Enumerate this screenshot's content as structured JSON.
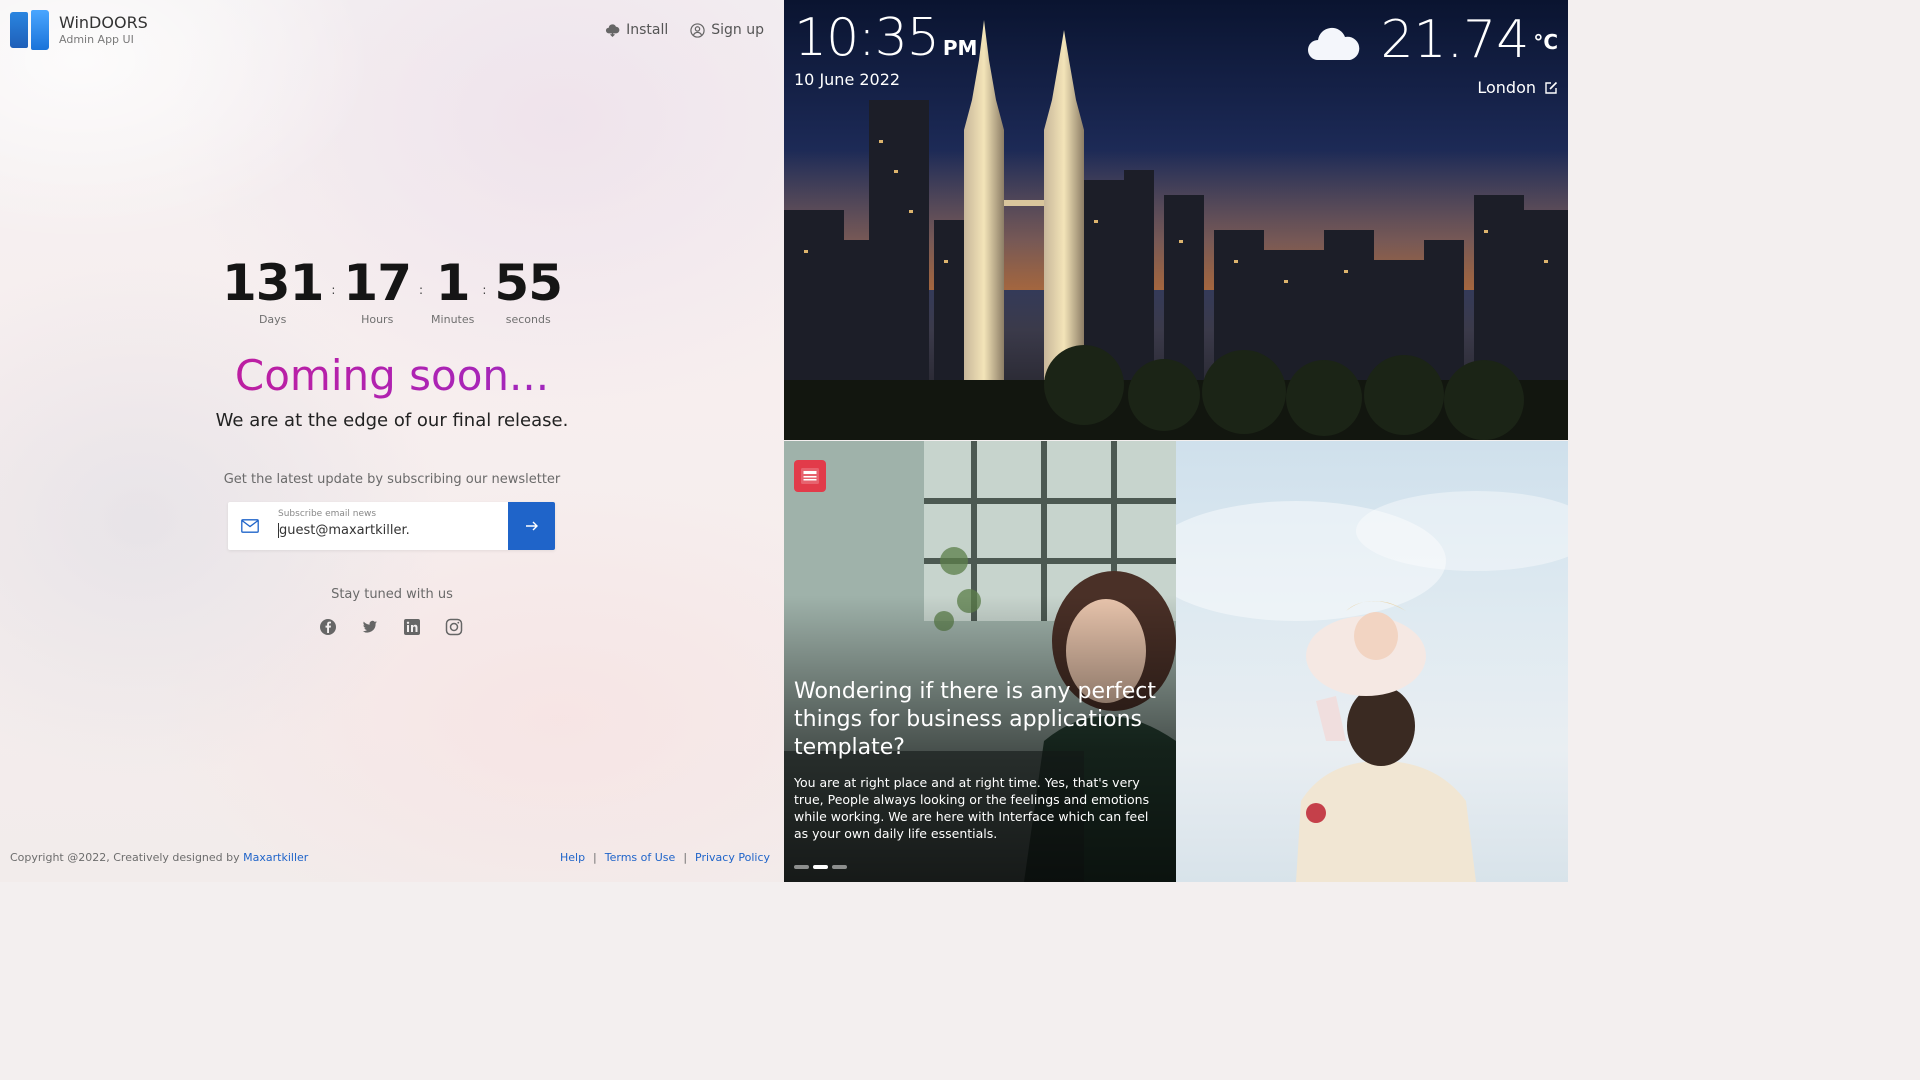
{
  "brand": {
    "title": "WinDOORS",
    "subtitle": "Admin App UI"
  },
  "topnav": {
    "install": "Install",
    "signup": "Sign up"
  },
  "countdown": {
    "days": "131",
    "days_label": "Days",
    "hours": "17",
    "hours_label": "Hours",
    "minutes": "1",
    "minutes_label": "Minutes",
    "seconds": "55",
    "seconds_label": "seconds",
    "separator": ":"
  },
  "hero": {
    "title": "Coming soon...",
    "tagline": "We are at the edge of our final release."
  },
  "newsletter": {
    "hint": "Get the latest update by subscribing our newsletter",
    "field_label": "Subscribe email news",
    "email_value": "guest@maxartkiller."
  },
  "social": {
    "heading": "Stay tuned with us",
    "icons": [
      "facebook-icon",
      "twitter-icon",
      "linkedin-icon",
      "instagram-icon"
    ]
  },
  "footer": {
    "copyright": "Copyright @2022, Creatively designed by",
    "author": "Maxartkiller",
    "links": {
      "help": "Help",
      "terms": "Terms of Use",
      "privacy": "Privacy Policy"
    },
    "separator": "|"
  },
  "clock": {
    "time": "10:35",
    "ampm": "PM",
    "date": "10 June 2022"
  },
  "weather": {
    "temp": "21.74",
    "unit": "°C",
    "location": "London",
    "icon": "cloud-icon"
  },
  "article": {
    "headline": "Wondering if there is any perfect things for business applications template?",
    "body": "You are at right place and at right time. Yes, that's very true, People always looking or the feelings and emotions while working. We are here with Interface which can feel as your own daily life essentials.",
    "slides": 3,
    "active_slide": 2
  },
  "colors": {
    "accent": "#1f64c9",
    "coming_soon_gradient": [
      "#d0198c",
      "#8a2fd0"
    ],
    "news_badge": "#e23b4a"
  }
}
